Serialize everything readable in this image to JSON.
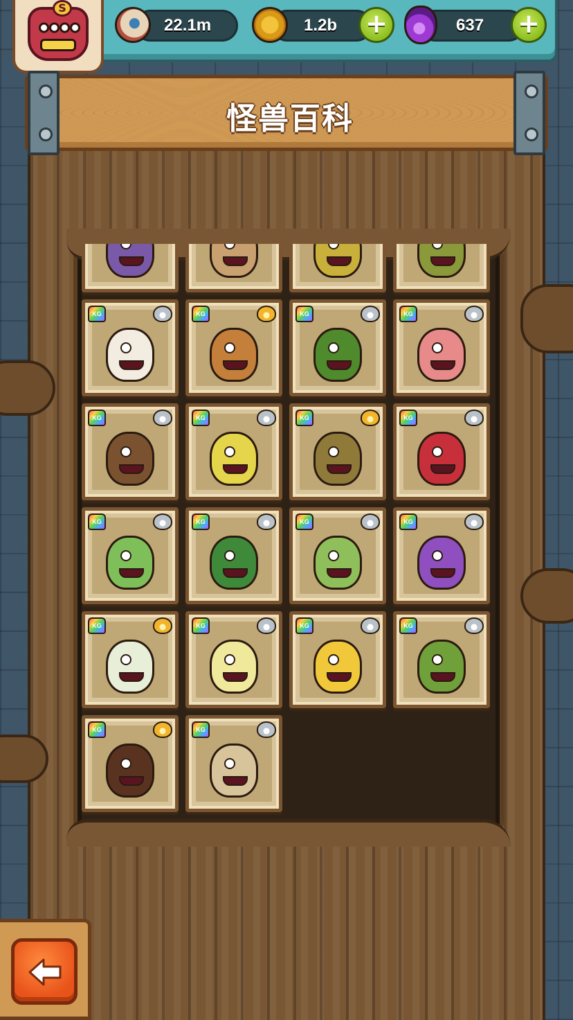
{
  "header": {
    "title": "怪兽百科"
  },
  "resources": {
    "eyes": {
      "icon": "eyeball-icon",
      "value": "22.1m"
    },
    "coins": {
      "icon": "coin-icon",
      "value": "1.2b"
    },
    "potions": {
      "icon": "potion-icon",
      "value": "637"
    }
  },
  "avatar": {
    "letter": "S"
  },
  "badge_text": "KG",
  "colors": {
    "hud_teal": "#58b8bd",
    "banner_wood": "#d09a55",
    "back_orange": "#e8531a",
    "plus_green": "#8cbf1f"
  },
  "cards": [
    {
      "monster": "tentacle-creature",
      "rarity": "silver",
      "color": "#7a5aa8"
    },
    {
      "monster": "twig-critter",
      "rarity": "silver",
      "color": "#c9a070"
    },
    {
      "monster": "yellow-blob-monster",
      "rarity": "silver",
      "color": "#c8b03a"
    },
    {
      "monster": "green-lizard",
      "rarity": "silver",
      "color": "#8a9a3a"
    },
    {
      "monster": "sheep-llama",
      "rarity": "silver",
      "color": "#f3ece0"
    },
    {
      "monster": "shell-creature",
      "rarity": "gold",
      "color": "#c4803a"
    },
    {
      "monster": "crocodile-plant",
      "rarity": "silver",
      "color": "#4f8a2c"
    },
    {
      "monster": "peach-monster",
      "rarity": "silver",
      "color": "#e88a8a"
    },
    {
      "monster": "hermit-crab",
      "rarity": "silver",
      "color": "#7a5230"
    },
    {
      "monster": "pear-bird",
      "rarity": "silver",
      "color": "#e5d54a"
    },
    {
      "monster": "cowboy-potato",
      "rarity": "gold",
      "color": "#8f7a3a"
    },
    {
      "monster": "red-lips-monster",
      "rarity": "silver",
      "color": "#c7303a"
    },
    {
      "monster": "cabbage-turtle",
      "rarity": "silver",
      "color": "#7fbf5a"
    },
    {
      "monster": "watermelon-chomper",
      "rarity": "silver",
      "color": "#3e8a3a"
    },
    {
      "monster": "herb-sprig",
      "rarity": "silver",
      "color": "#8fbf5a"
    },
    {
      "monster": "grape-spider",
      "rarity": "silver",
      "color": "#8f4fbf"
    },
    {
      "monster": "daikon-radish",
      "rarity": "gold",
      "color": "#e8efd8"
    },
    {
      "monster": "cauliflower-flower",
      "rarity": "silver",
      "color": "#f0e89a"
    },
    {
      "monster": "cheese-wedge",
      "rarity": "silver",
      "color": "#f0c83a"
    },
    {
      "monster": "medusa-plant",
      "rarity": "silver",
      "color": "#6fa03a"
    },
    {
      "monster": "hairy-beast",
      "rarity": "gold",
      "color": "#5a3320"
    },
    {
      "monster": "onion-creature",
      "rarity": "silver",
      "color": "#d8c49a"
    }
  ]
}
